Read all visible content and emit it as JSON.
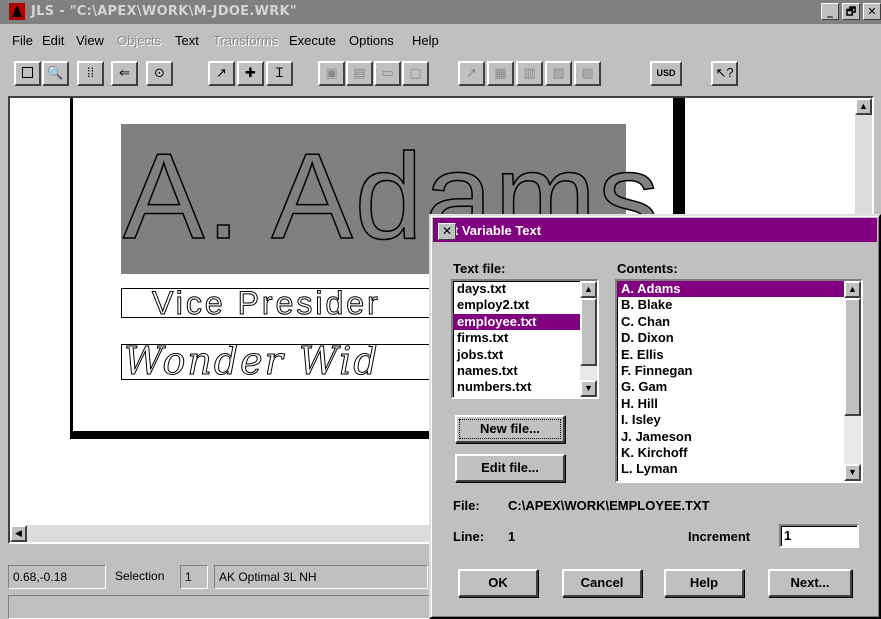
{
  "window": {
    "title": "JLS - \"C:\\APEX\\WORK\\M-JDOE.WRK\"",
    "controls": [
      "_",
      "🗗",
      "✕"
    ]
  },
  "menu": {
    "items": [
      {
        "label": "File",
        "enabled": true
      },
      {
        "label": "Edit",
        "enabled": true
      },
      {
        "label": "View",
        "enabled": true
      },
      {
        "label": "Objects",
        "enabled": false
      },
      {
        "label": "Text",
        "enabled": true
      },
      {
        "label": "Transforms",
        "enabled": false
      },
      {
        "label": "Execute",
        "enabled": true
      },
      {
        "label": "Options",
        "enabled": true
      },
      {
        "label": "Help",
        "enabled": true
      }
    ]
  },
  "toolbar": {
    "usd_label": "USD",
    "buttons": [
      "select-icon",
      "zoom-icon",
      "grid-icon",
      "back-icon",
      "eye-icon",
      "pointer-icon",
      "plus-icon",
      "text-cursor-icon",
      "usd-button",
      "help-pointer-icon"
    ]
  },
  "canvas": {
    "name_text": "A. Adams",
    "title_text": "Vice Presider",
    "firm_text": "Wonder Wid"
  },
  "status": {
    "coords": "0.68,-0.18",
    "selection_label": "Selection",
    "selection_count": "1",
    "font": "AK Optimal 3L NH"
  },
  "dialog": {
    "title": "Set Variable Text",
    "close": "✕",
    "text_file_label": "Text file:",
    "contents_label": "Contents:",
    "text_files": [
      "days.txt",
      "employ2.txt",
      "employee.txt",
      "firms.txt",
      "jobs.txt",
      "names.txt",
      "numbers.txt"
    ],
    "selected_file": "employee.txt",
    "contents": [
      "A. Adams",
      "B. Blake",
      "C. Chan",
      "D. Dixon",
      "E. Ellis",
      "F. Finnegan",
      "G. Gam",
      "H. Hill",
      "I. Isley",
      "J. Jameson",
      "K. Kirchoff",
      "L. Lyman"
    ],
    "selected_content": "A. Adams",
    "new_file_button": "New file...",
    "edit_file_button": "Edit file...",
    "file_label": "File:",
    "file_path": "C:\\APEX\\WORK\\EMPLOYEE.TXT",
    "line_label": "Line:",
    "line_value": "1",
    "increment_label": "Increment",
    "increment_value": "1",
    "ok_button": "OK",
    "cancel_button": "Cancel",
    "help_button": "Help",
    "next_button": "Next..."
  }
}
